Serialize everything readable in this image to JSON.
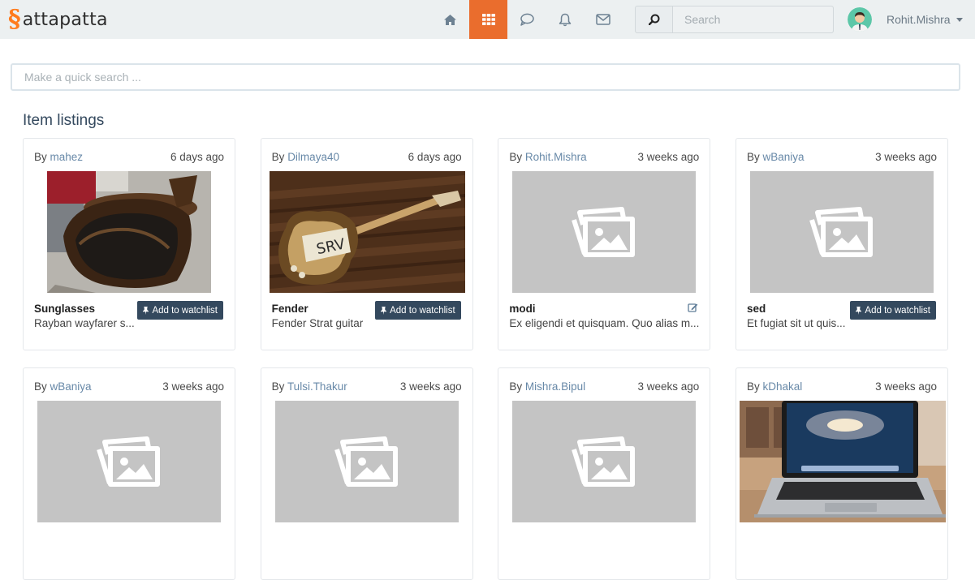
{
  "brand": {
    "mark": "§",
    "name": "attapatta"
  },
  "nav": {
    "icons": [
      "home-icon",
      "grid-icon",
      "chat-icon",
      "bell-icon",
      "mail-icon"
    ],
    "active": "grid-icon",
    "accent": "#ea6d2d"
  },
  "search": {
    "placeholder": "Search"
  },
  "user": {
    "name": "Rohit.Mishra"
  },
  "quick_search": {
    "placeholder": "Make a quick search ..."
  },
  "section": {
    "title": "Item listings"
  },
  "colors": {
    "button": "#34495e",
    "link": "#6889a8",
    "placeholder": "#c4c4c4"
  },
  "listings": [
    {
      "by": "By",
      "user": "mahez",
      "time": "6 days ago",
      "title": "Sunglasses",
      "desc": "Rayban wayfarer s...",
      "action": "Add to watchlist",
      "image": "sunglasses-photo"
    },
    {
      "by": "By",
      "user": "Dilmaya40",
      "time": "6 days ago",
      "title": "Fender",
      "desc": "Fender Strat guitar",
      "action": "Add to watchlist",
      "image": "guitar-photo"
    },
    {
      "by": "By",
      "user": "Rohit.Mishra",
      "time": "3 weeks ago",
      "title": "modi",
      "desc": "Ex eligendi et quisquam. Quo alias m...",
      "action": "edit",
      "image": "placeholder"
    },
    {
      "by": "By",
      "user": "wBaniya",
      "time": "3 weeks ago",
      "title": "sed",
      "desc": "Et fugiat sit ut quis...",
      "action": "Add to watchlist",
      "image": "placeholder"
    },
    {
      "by": "By",
      "user": "wBaniya",
      "time": "3 weeks ago",
      "image": "placeholder"
    },
    {
      "by": "By",
      "user": "Tulsi.Thakur",
      "time": "3 weeks ago",
      "image": "placeholder"
    },
    {
      "by": "By",
      "user": "Mishra.Bipul",
      "time": "3 weeks ago",
      "image": "placeholder"
    },
    {
      "by": "By",
      "user": "kDhakal",
      "time": "3 weeks ago",
      "image": "laptop-photo"
    }
  ]
}
